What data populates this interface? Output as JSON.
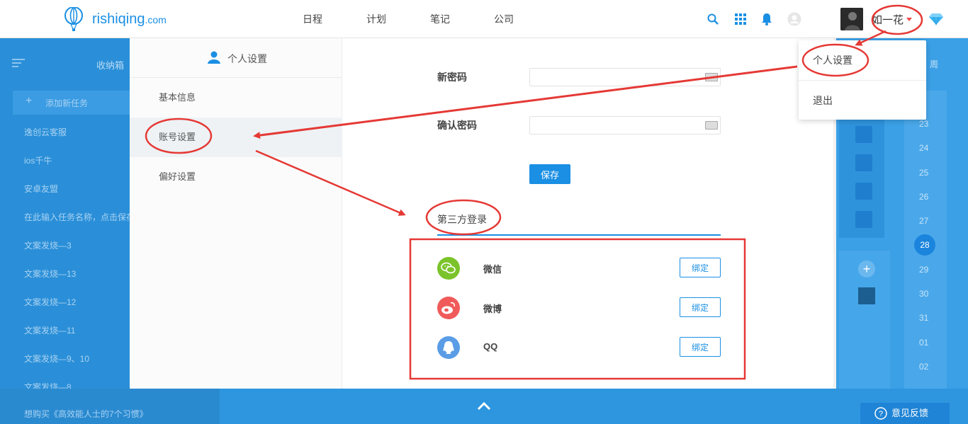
{
  "header": {
    "logo_text": "rishiqing",
    "logo_domain": ".com",
    "nav": [
      "日程",
      "计划",
      "笔记",
      "公司"
    ],
    "user_name": "如一花",
    "icons": [
      "search-icon",
      "grid-icon",
      "bell-icon",
      "user-circle-icon",
      "diamond-icon"
    ],
    "accent_color": "#1a8fe3"
  },
  "dropdown": {
    "items": [
      "个人设置",
      "退出"
    ]
  },
  "background": {
    "inbox_title": "收纳箱",
    "add_task": "添加新任务",
    "tasks": [
      "逸创云客服",
      "ios千牛",
      "安卓友盟",
      "在此输入任务名称，点击保存",
      "文案发烧—3",
      "文案发烧—13",
      "文案发烧—12",
      "文案发烧—11",
      "文案发烧—9、10",
      "文案发烧—8",
      "想购买《高效能人士的7个习惯》"
    ],
    "week_label": "周",
    "calendar_days": [
      "23",
      "24",
      "25",
      "26",
      "27",
      "28",
      "29",
      "30",
      "31",
      "01",
      "02"
    ],
    "today": "28",
    "feedback": "意见反馈"
  },
  "settings": {
    "title": "个人设置",
    "menu": [
      "基本信息",
      "账号设置",
      "偏好设置"
    ],
    "active_menu": "账号设置",
    "new_password_label": "新密码",
    "new_password_value": "",
    "confirm_password_label": "确认密码",
    "confirm_password_value": "",
    "save_label": "保存",
    "third_party_title": "第三方登录",
    "third_party": [
      {
        "name": "微信",
        "icon": "wechat-icon",
        "color": "#7bc32a",
        "action": "绑定"
      },
      {
        "name": "微博",
        "icon": "weibo-icon",
        "color": "#f05a5a",
        "action": "绑定"
      },
      {
        "name": "QQ",
        "icon": "qq-icon",
        "color": "#5a9de6",
        "action": "绑定"
      }
    ]
  },
  "annotation_color": "#e53935"
}
